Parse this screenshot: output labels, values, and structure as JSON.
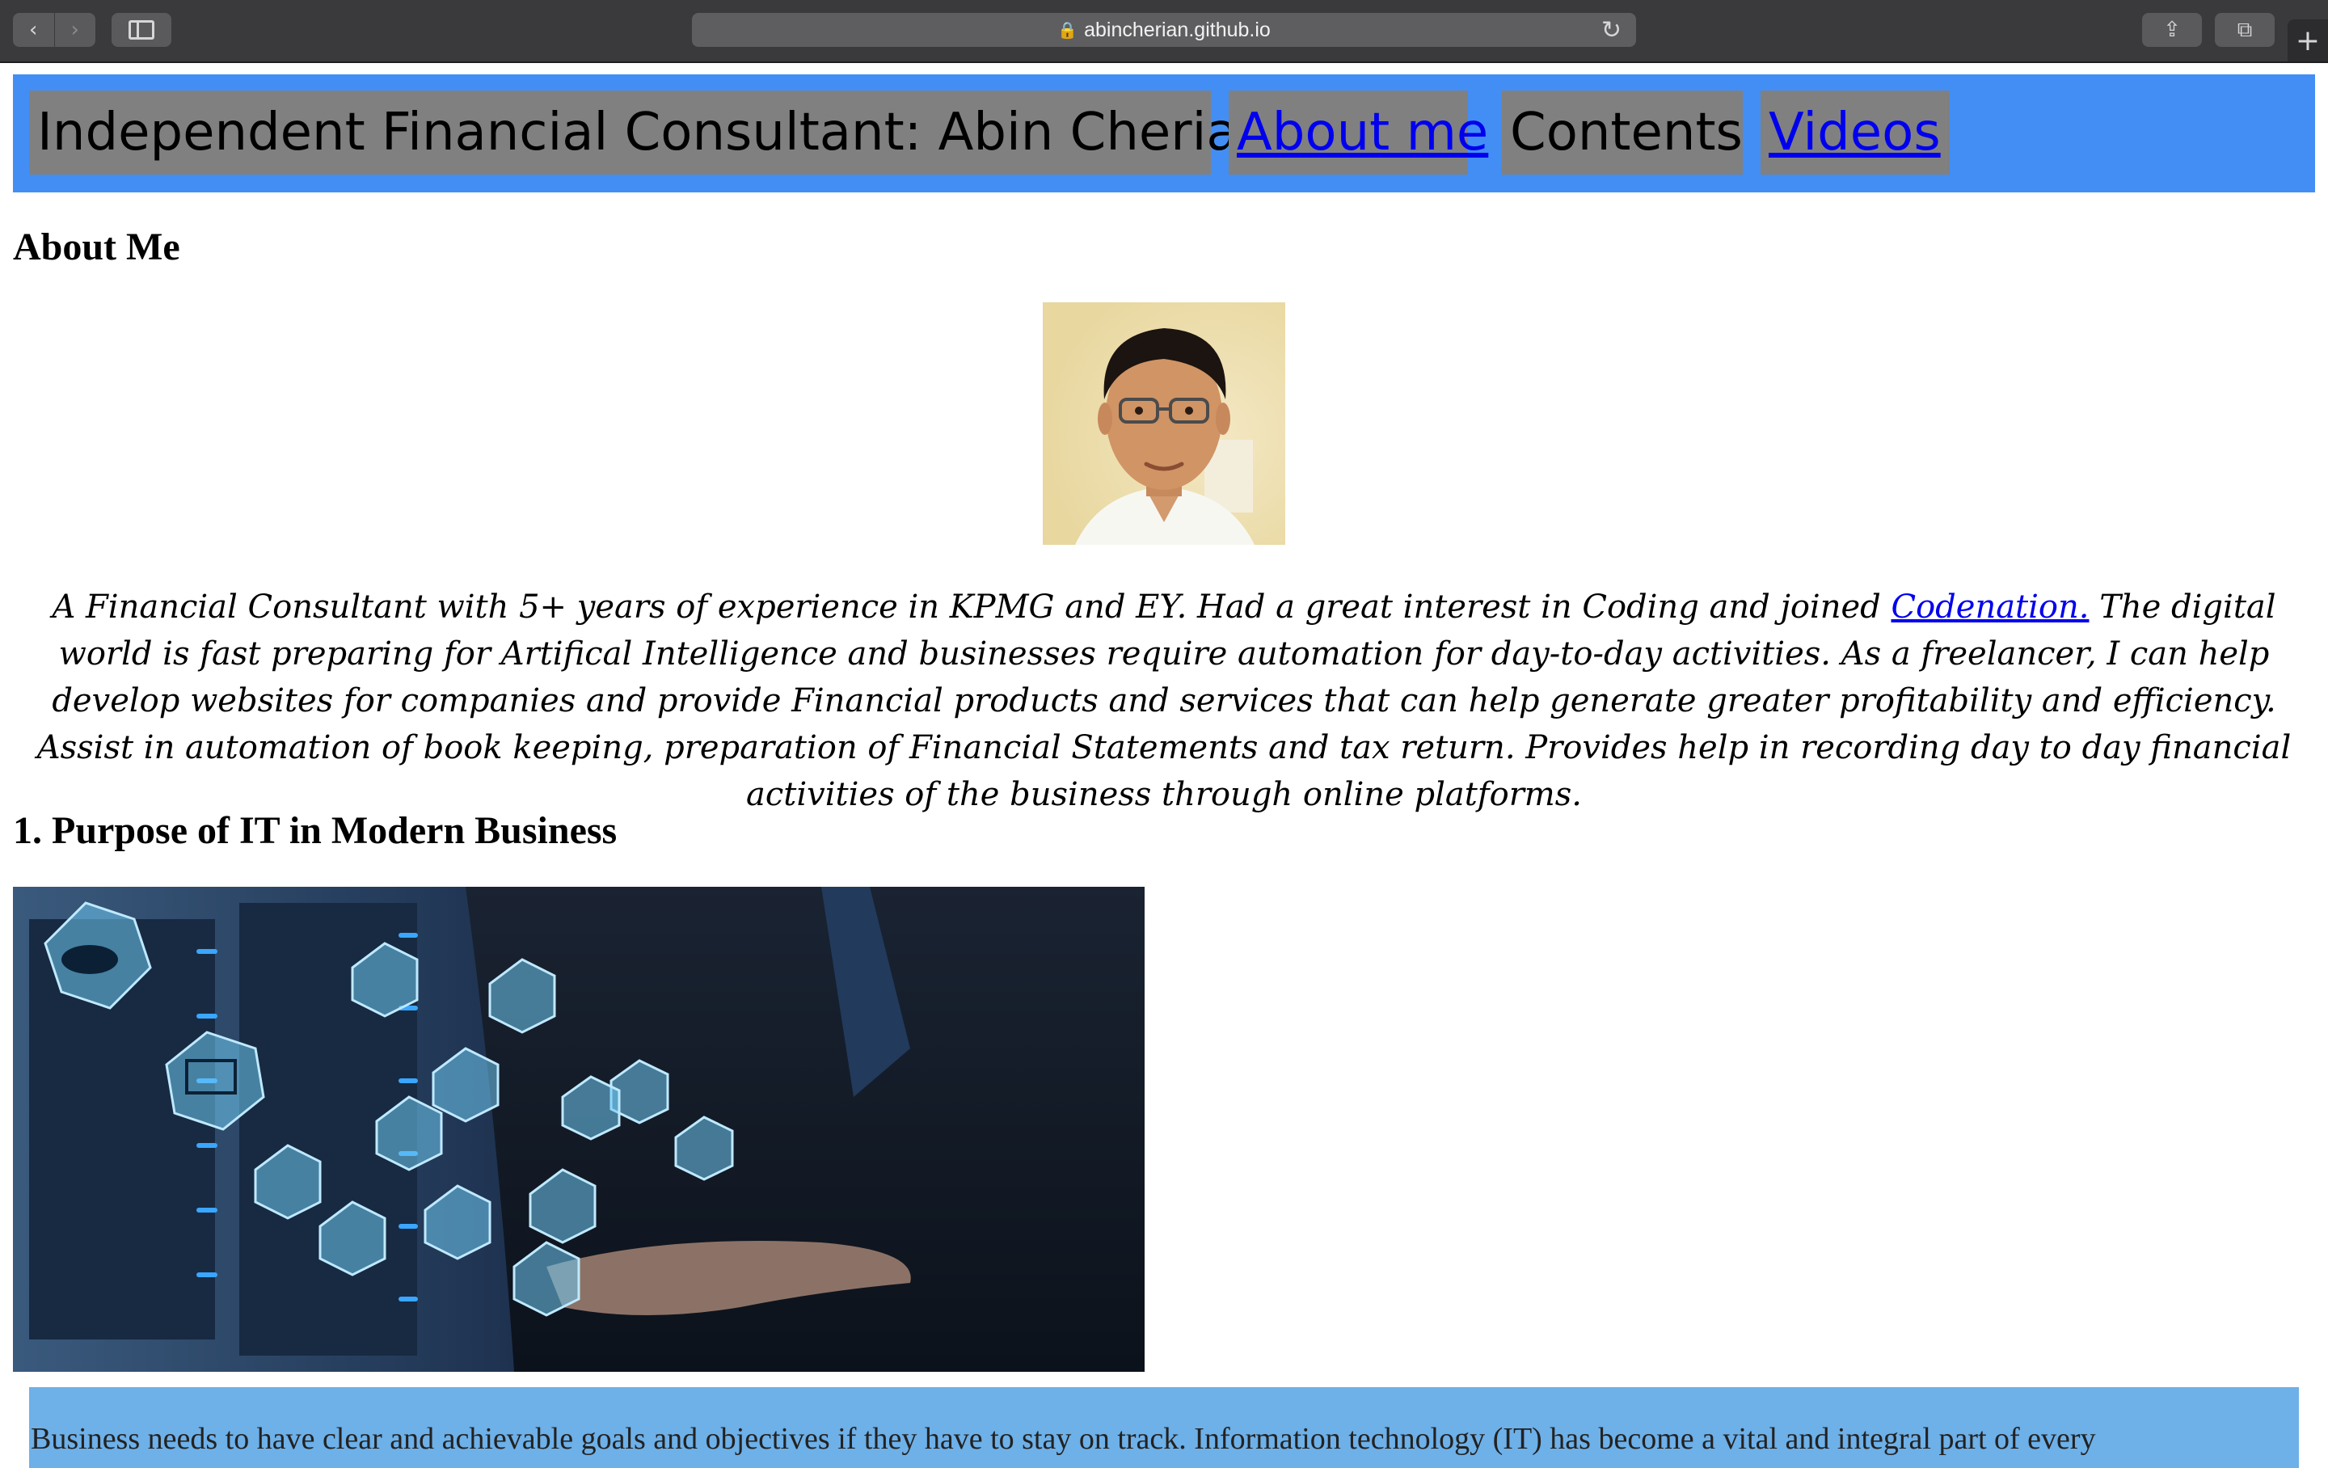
{
  "browser": {
    "url": "abincherian.github.io",
    "back_icon": "‹",
    "forward_icon": "›",
    "reload_icon": "↻",
    "lock_icon": "🔒",
    "share_icon": "⇪",
    "tabs_icon": "⧉",
    "new_tab_icon": "+"
  },
  "nav": {
    "title": "Independent Financial Consultant: Abin Cherian",
    "about": "About me",
    "contents": "Contents",
    "videos": "Videos"
  },
  "about": {
    "heading": "About Me",
    "bio_before": "A Financial Consultant with 5+ years of experience in KPMG and EY. Had a great interest in Coding and joined ",
    "bio_link": "Codenation.",
    "bio_after": " The digital world is fast preparing for Artifical Intelligence and businesses require automation for day-to-day activities. As a freelancer, I can help develop websites for companies and provide Financial products and services that can help generate greater profitability and efficiency. Assist in automation of book keeping, preparation of Financial Statements and tax return. Provides help in recording day to day financial activities of the business through online platforms."
  },
  "purpose": {
    "heading": "1. Purpose of IT in Modern Business",
    "paragraph": "Business needs to have clear and achievable goals and objectives if they have to stay on track. Information technology (IT) has become a vital and integral part of every"
  },
  "colors": {
    "nav_background": "#428ef5",
    "nav_item_background": "#808080",
    "link": "#0000ee",
    "info_box_background": "#6eb0e8"
  }
}
